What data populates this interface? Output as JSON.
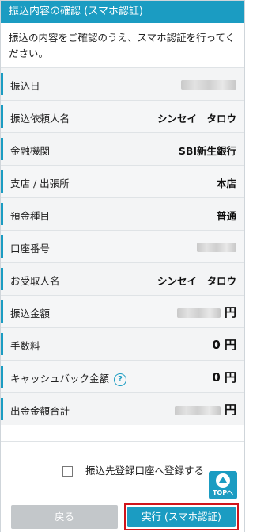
{
  "header": {
    "title": "振込内容の確認 (スマホ認証)"
  },
  "intro": {
    "text": "振込の内容をご確認のうえ、スマホ認証を行ってください。"
  },
  "rows": [
    {
      "label": "振込日",
      "value": "",
      "blurred": true
    },
    {
      "label": "振込依頼人名",
      "value": "シンセイ　タロウ"
    },
    {
      "label": "金融機関",
      "value": "SBI新生銀行"
    },
    {
      "label": "支店 / 出張所",
      "value": "本店"
    },
    {
      "label": "預金種目",
      "value": "普通"
    },
    {
      "label": "口座番号",
      "value": "",
      "blurred": true
    },
    {
      "label": "お受取人名",
      "value": "シンセイ　タロウ"
    },
    {
      "label": "振込金額",
      "value": "",
      "unit": "円",
      "blurred": true
    },
    {
      "label": "手数料",
      "value": "0",
      "unit": "円"
    },
    {
      "label": "キャッシュバック金額",
      "value": "0",
      "unit": "円",
      "help_icon": "question-icon"
    },
    {
      "label": "出金金額合計",
      "value": "",
      "unit": "円",
      "blurred": true
    }
  ],
  "register_checkbox": {
    "label": "振込先登録口座へ登録する",
    "checked": false
  },
  "top_button": {
    "label": "TOPへ"
  },
  "back_button": {
    "label": "戻る"
  },
  "execute_button": {
    "label": "実行 (スマホ認証)"
  },
  "colors": {
    "accent": "#1b9cc2",
    "highlight": "#d0141b",
    "disabled": "#c3c7ca"
  }
}
